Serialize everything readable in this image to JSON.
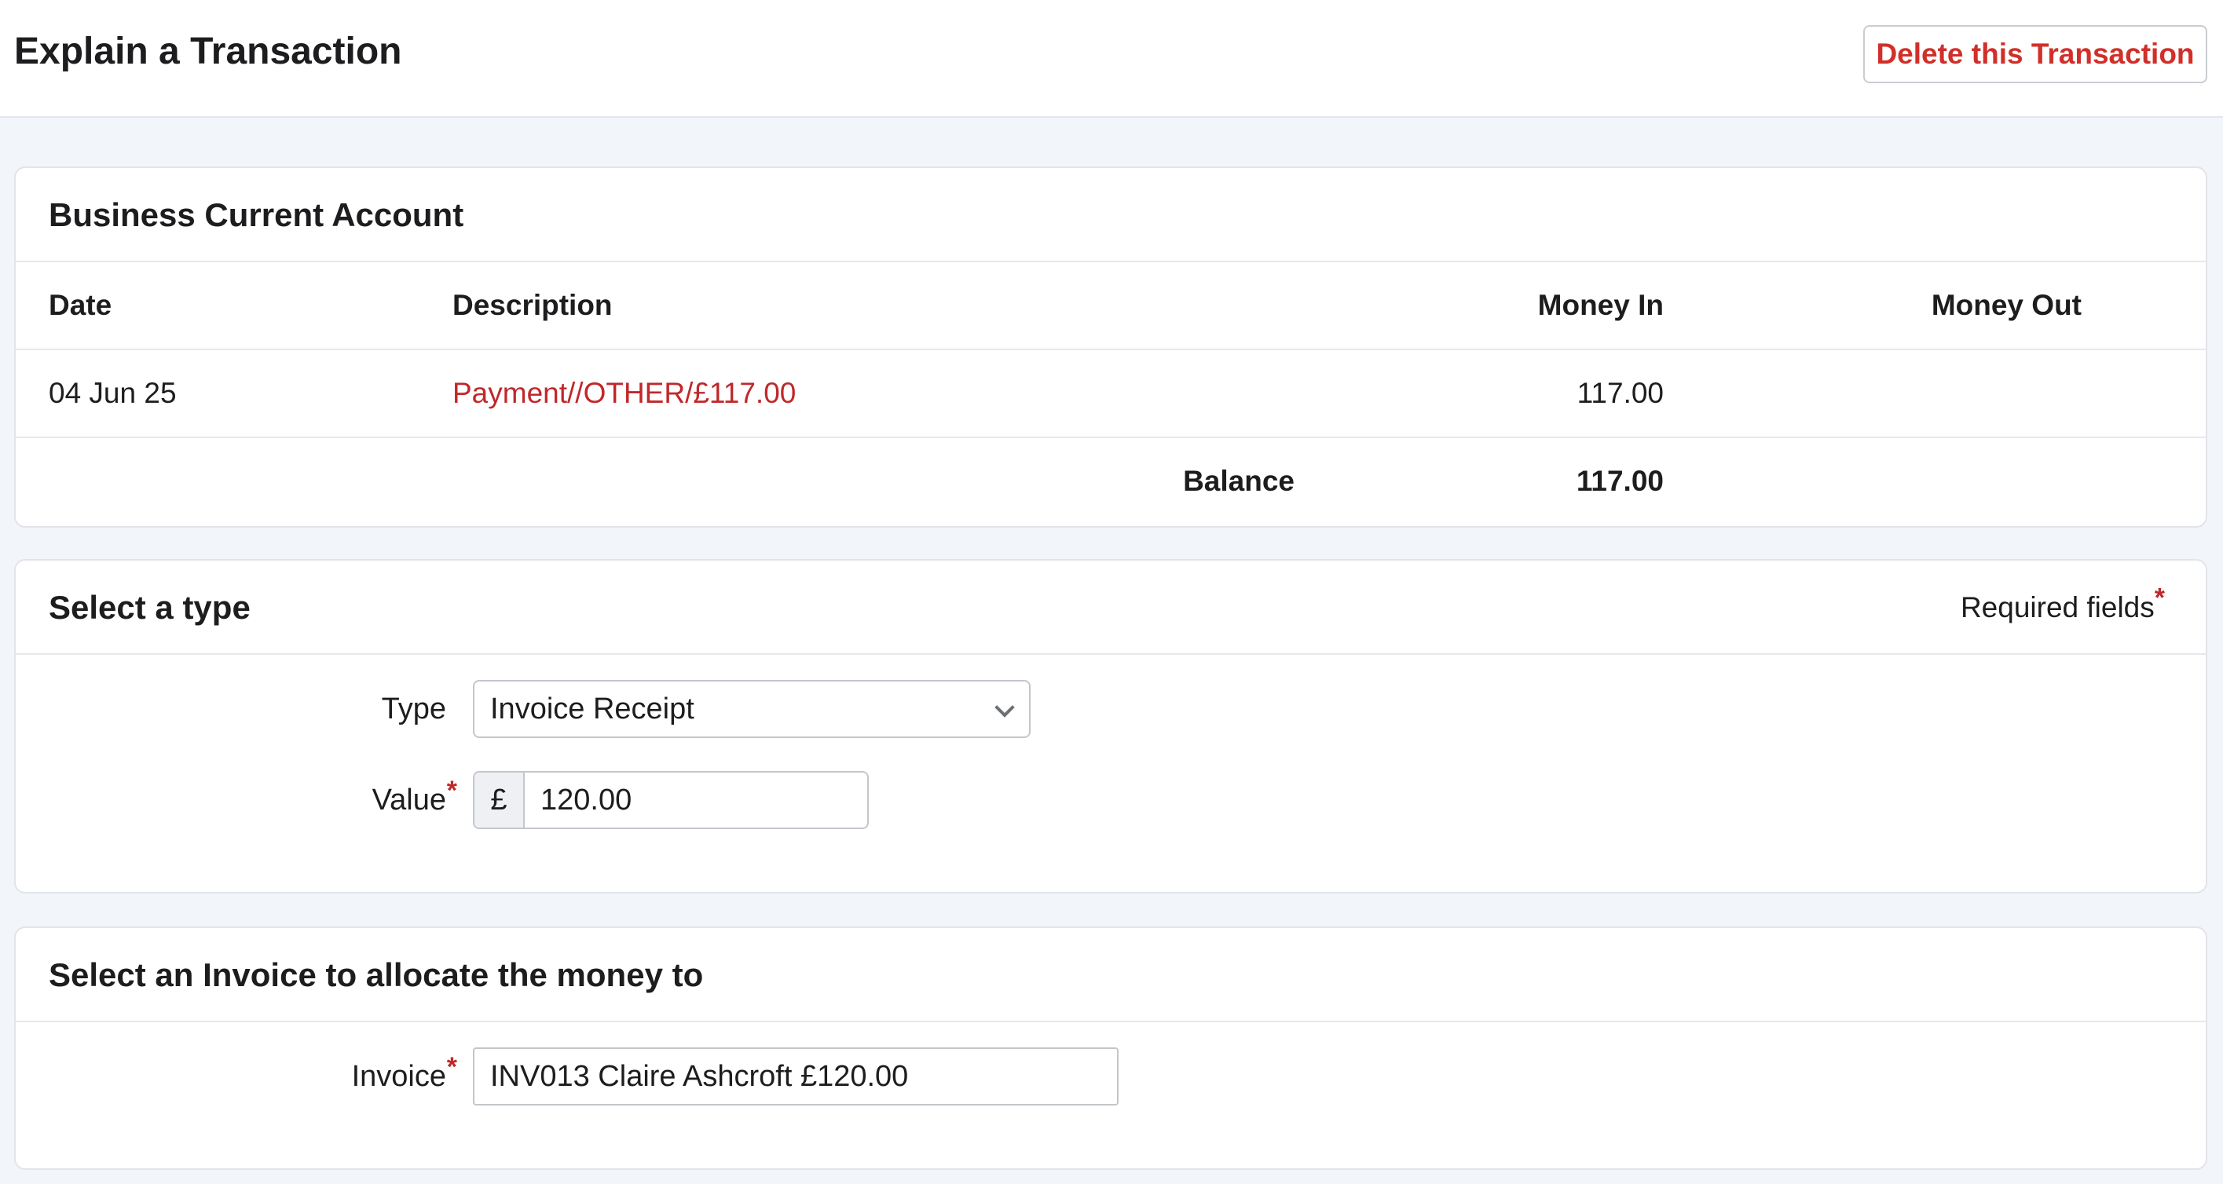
{
  "header": {
    "title": "Explain a Transaction",
    "delete_label": "Delete this Transaction"
  },
  "account": {
    "title": "Business Current Account",
    "columns": {
      "date": "Date",
      "description": "Description",
      "money_in": "Money In",
      "money_out": "Money Out"
    },
    "rows": [
      {
        "date": "04 Jun 25",
        "description": "Payment//OTHER/£117.00",
        "money_in": "117.00",
        "money_out": ""
      }
    ],
    "balance_label": "Balance",
    "balance_value": "117.00"
  },
  "type_section": {
    "title": "Select a type",
    "required_label": "Required fields",
    "required_marker": "*",
    "type_label": "Type",
    "type_value": "Invoice Receipt",
    "value_label": "Value",
    "currency_symbol": "£",
    "value": "120.00"
  },
  "invoice_section": {
    "title": "Select an Invoice to allocate the money to",
    "invoice_label": "Invoice",
    "invoice_value": "INV013 Claire Ashcroft £120.00"
  },
  "colors": {
    "accent_red": "#c0282a",
    "delete_red": "#d12f2a",
    "background": "#f2f5fa"
  },
  "icons": {
    "type_dropdown": "chevron-down-icon"
  }
}
